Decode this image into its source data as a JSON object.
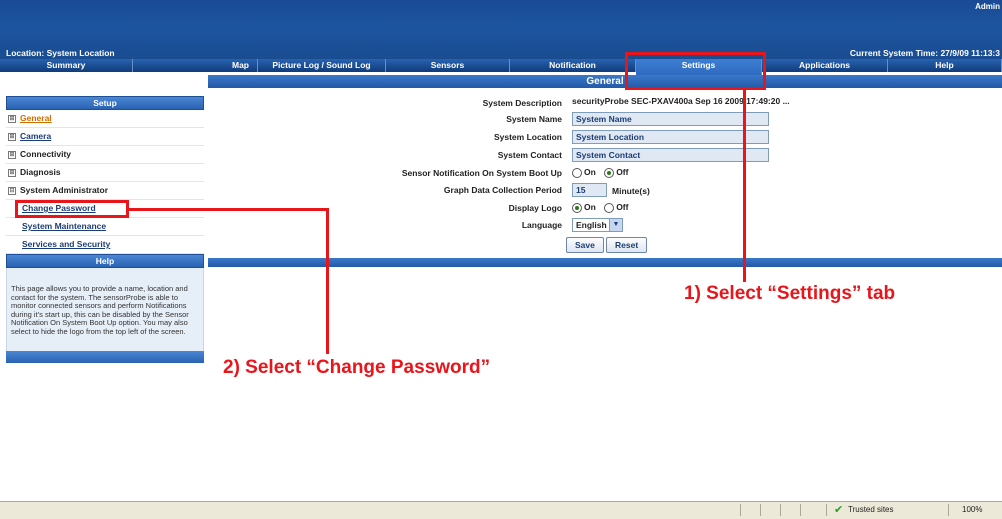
{
  "header": {
    "admin_label": "Admin",
    "location": "Location: System Location",
    "time": "Current System Time: 27/9/09 11:13:3"
  },
  "tabs": [
    "Summary",
    "Map",
    "Picture Log / Sound Log",
    "Sensors",
    "Notification",
    "Settings",
    "Applications",
    "Help"
  ],
  "page_title": "General",
  "sidebar": {
    "setup_title": "Setup",
    "items": [
      {
        "label": "General",
        "sign": "⊞"
      },
      {
        "label": "Camera",
        "sign": "⊞"
      },
      {
        "label": "Connectivity",
        "sign": "⊞"
      },
      {
        "label": "Diagnosis",
        "sign": "⊞"
      },
      {
        "label": "System Administrator",
        "sign": "⊟"
      }
    ],
    "subitems": [
      "Change Password",
      "System Maintenance",
      "Services and Security"
    ],
    "help_title": "Help",
    "help_text": "This page allows you to provide a name, location and contact for the system. The sensorProbe is able to monitor connected sensors and perform Notifications during it's start up, this can be disabled by the Sensor Notification On System Boot Up option. You may also select to hide the logo from the top left of the screen."
  },
  "form": {
    "description_label": "System Description",
    "description_value": "securityProbe SEC-PXAV400a Sep 16 2009 17:49:20 ...",
    "name_label": "System Name",
    "name_value": "System Name",
    "location_label": "System Location",
    "location_value": "System Location",
    "contact_label": "System Contact",
    "contact_value": "System Contact",
    "boot_label": "Sensor Notification On System Boot Up",
    "period_label": "Graph Data Collection Period",
    "period_value": "15",
    "period_unit": "Minute(s)",
    "logo_label": "Display Logo",
    "language_label": "Language",
    "language_value": "English",
    "on_label": "On",
    "off_label": "Off",
    "boot_selected": "Off",
    "logo_selected": "On",
    "save_label": "Save",
    "reset_label": "Reset"
  },
  "annotations": {
    "step1": "1) Select “Settings” tab",
    "step2": "2) Select “Change Password”",
    "color": "#e8151b"
  },
  "statusbar": {
    "zone": "Trusted sites",
    "zoom": "100%"
  }
}
